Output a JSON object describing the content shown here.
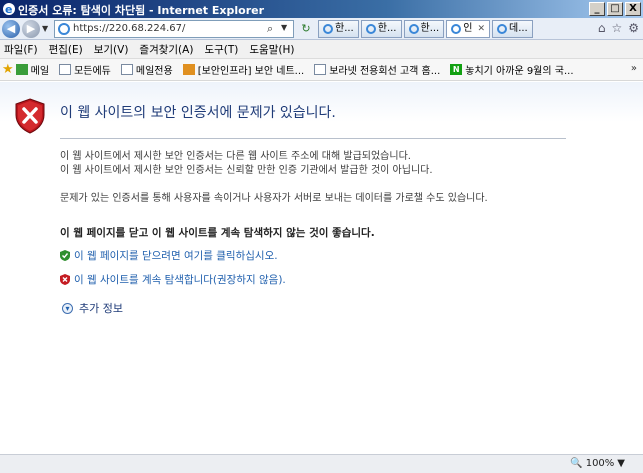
{
  "window": {
    "title": "인증서 오류: 탐색이 차단됨 - Internet Explorer",
    "buttons": {
      "minimize": "_",
      "maximize": "□",
      "close": "X"
    }
  },
  "address": {
    "url": "https://220.68.224.67/",
    "tabs": [
      {
        "label": "한...",
        "active": false
      },
      {
        "label": "한...",
        "active": false
      },
      {
        "label": "한...",
        "active": false
      },
      {
        "label": "인",
        "active": true
      },
      {
        "label": "데...",
        "active": false
      }
    ]
  },
  "menu": {
    "items": [
      "파일(F)",
      "편집(E)",
      "보기(V)",
      "즐겨찾기(A)",
      "도구(T)",
      "도움말(H)"
    ]
  },
  "favorites": {
    "items": [
      {
        "label": "메일",
        "icon": "mail-icon"
      },
      {
        "label": "모든에듀",
        "icon": "page-icon"
      },
      {
        "label": "메일전용",
        "icon": "page-icon"
      },
      {
        "label": "[보안인프라] 보안 네트...",
        "icon": "orange-icon"
      },
      {
        "label": "보라넷 전용회선 고객 홈...",
        "icon": "page-icon"
      },
      {
        "label": "놓치기 아까운 9월의 국...",
        "icon": "naver-icon"
      }
    ],
    "more": "»"
  },
  "content": {
    "heading": "이 웹 사이트의 보안 인증서에 문제가 있습니다.",
    "para1_line1": "이 웹 사이트에서 제시한 보안 인증서는 다른 웹 사이트 주소에 대해 발급되었습니다.",
    "para1_line2": "이 웹 사이트에서 제시한 보안 인증서는 신뢰할 만한 인증 기관에서 발급한 것이 아닙니다.",
    "para2": "문제가 있는 인증서를 통해 사용자를 속이거나 사용자가 서버로 보내는 데이터를 가로챌 수도 있습니다.",
    "strong": "이 웹 페이지를 닫고 이 웹 사이트를 계속 탐색하지 않는 것이 좋습니다.",
    "option_close": "이 웹 페이지를 닫으려면 여기를 클릭하십시오.",
    "option_continue": "이 웹 사이트를 계속 탐색합니다(권장하지 않음).",
    "more_info": "추가 정보"
  },
  "status": {
    "zoom": "100%"
  },
  "colors": {
    "heading": "#1f3b78",
    "link": "#1f5fad"
  }
}
